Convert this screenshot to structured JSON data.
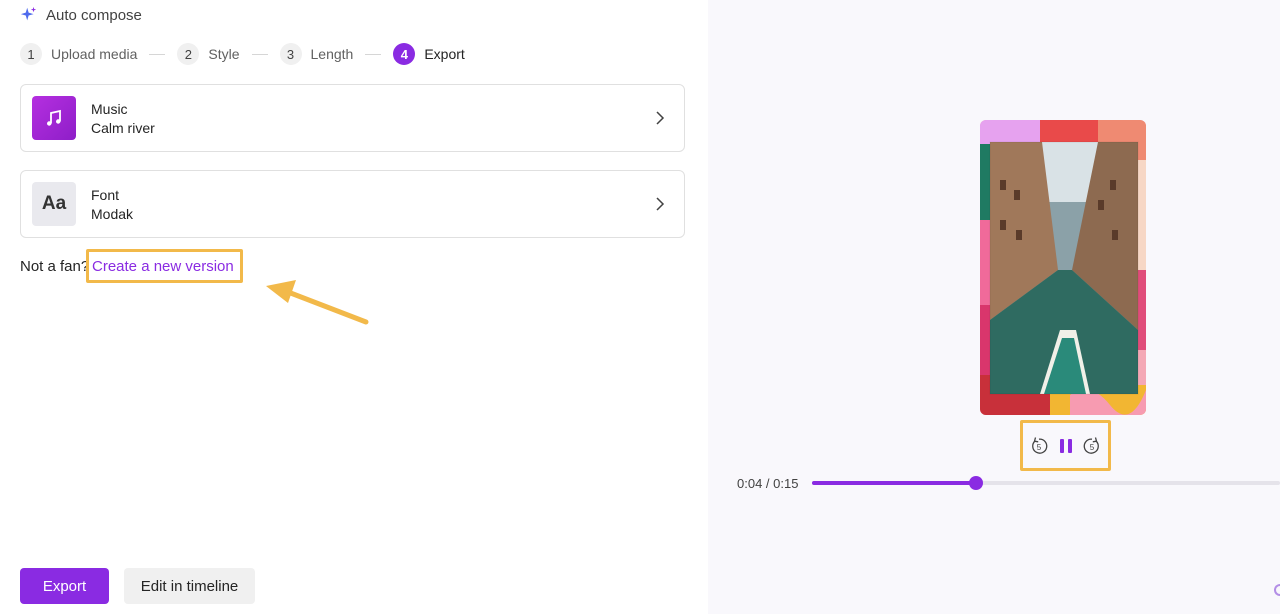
{
  "header": {
    "title": "Auto compose",
    "icon": "sparkle-icon"
  },
  "steps": [
    {
      "num": "1",
      "label": "Upload media"
    },
    {
      "num": "2",
      "label": "Style"
    },
    {
      "num": "3",
      "label": "Length"
    },
    {
      "num": "4",
      "label": "Export",
      "active": true
    }
  ],
  "cards": {
    "music": {
      "title": "Music",
      "value": "Calm river",
      "icon": "music-note-icon"
    },
    "font": {
      "title": "Font",
      "value": "Modak",
      "icon_text": "Aa"
    }
  },
  "regenerate": {
    "prompt": "Not a fan?",
    "link": "Create a new version"
  },
  "buttons": {
    "export": "Export",
    "edit": "Edit in timeline"
  },
  "player": {
    "time": "0:04 / 0:15",
    "progress": 0.35,
    "rewind_seconds": "5",
    "forward_seconds": "5"
  },
  "colors": {
    "accent": "#8a2be2",
    "highlight": "#f2b94a"
  }
}
